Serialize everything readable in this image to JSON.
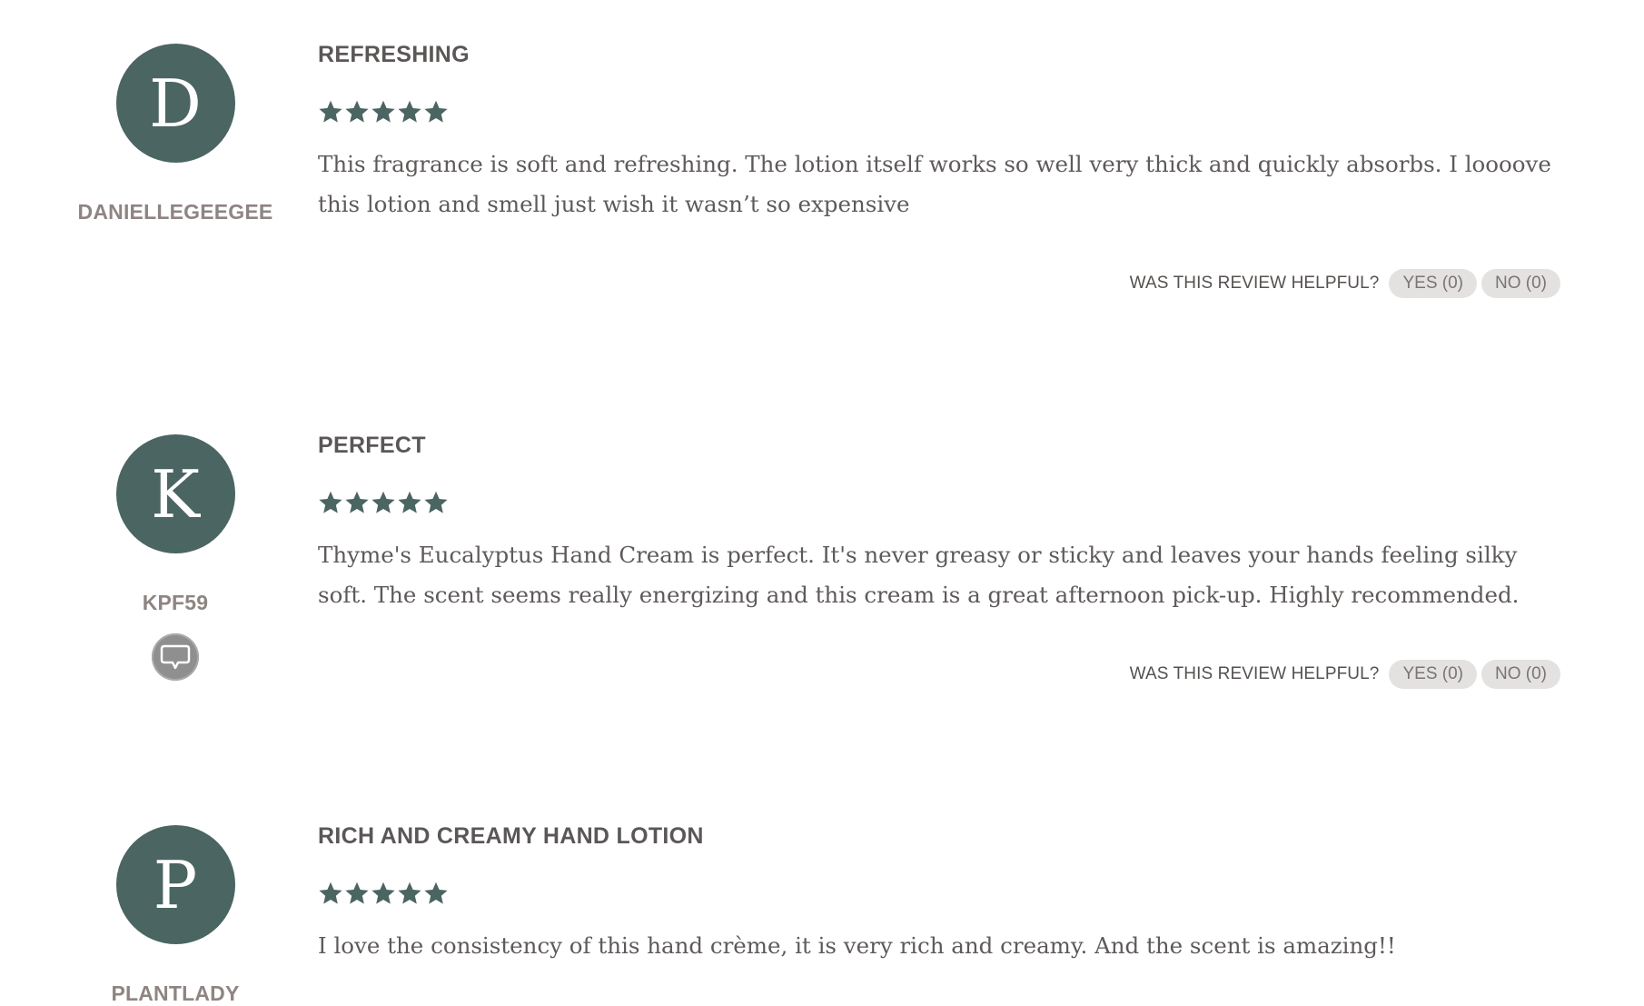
{
  "reviews": [
    {
      "initial": "D",
      "username": "DANIELLEGEEGEE",
      "title": "REFRESHING",
      "rating": 5,
      "body": "This fragrance is soft and refreshing. The lotion itself works so well very thick and quickly absorbs. I loooove this lotion and smell just wish it wasn’t so expensive",
      "helpful_label": "WAS THIS REVIEW HELPFUL?",
      "yes_label": "YES (0)",
      "no_label": "NO (0)"
    },
    {
      "initial": "K",
      "username": "KPF59",
      "badge_icon": "speech-bubble-icon",
      "title": "PERFECT",
      "rating": 5,
      "body": "Thyme's Eucalyptus Hand Cream is perfect. It's never greasy or sticky and leaves your hands feeling silky soft. The scent seems really energizing and this cream is a great afternoon pick-up. Highly recommended.",
      "helpful_label": "WAS THIS REVIEW HELPFUL?",
      "yes_label": "YES (0)",
      "no_label": "NO (0)"
    },
    {
      "initial": "P",
      "username": "PLANTLADY",
      "title": "RICH AND CREAMY HAND LOTION",
      "rating": 5,
      "body": "I love the consistency of this hand crème, it is very rich and creamy. And the scent is amazing!!"
    }
  ],
  "colors": {
    "avatar_bg": "#4a6562",
    "star_fill": "#4a6562",
    "username": "#8e8582",
    "vote_bg": "#e4e2e1"
  }
}
